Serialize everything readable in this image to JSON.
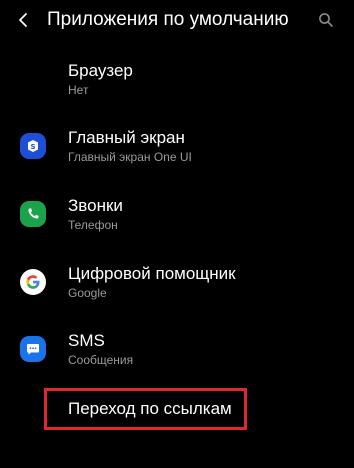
{
  "header": {
    "title": "Приложения по умолчанию",
    "back_icon": "chevron-left-icon",
    "search_icon": "search-icon"
  },
  "items": [
    {
      "title": "Браузер",
      "subtitle": "Нет",
      "icon": "none"
    },
    {
      "title": "Главный экран",
      "subtitle": "Главный экран One UI",
      "icon": "home-screen-icon",
      "color": "#1f4fd6"
    },
    {
      "title": "Звонки",
      "subtitle": "Телефон",
      "icon": "phone-icon",
      "color": "#1aa34a"
    },
    {
      "title": "Цифровой помощник",
      "subtitle": "Google",
      "icon": "google-icon",
      "color": "#ffffff"
    },
    {
      "title": "SMS",
      "subtitle": "Сообщения",
      "icon": "messages-icon",
      "color": "#1a73e8"
    }
  ],
  "link_handling": {
    "title": "Переход по ссылкам",
    "highlight_color": "#e0262e"
  }
}
